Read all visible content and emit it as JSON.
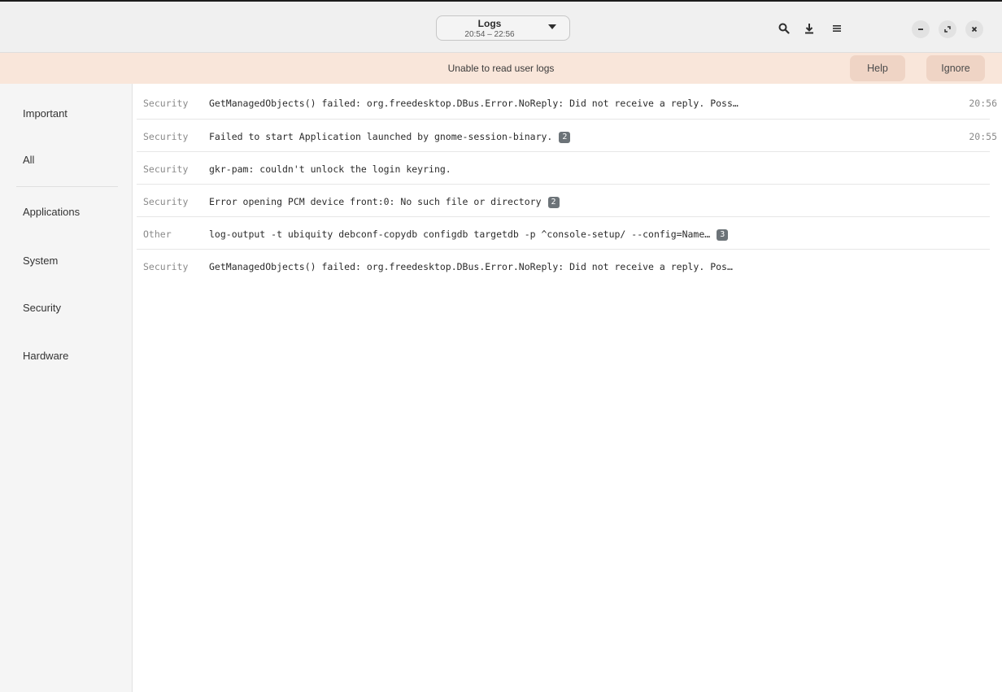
{
  "header": {
    "title": "Logs",
    "time_range": "20:54 – 22:56"
  },
  "infobar": {
    "message": "Unable to read user logs",
    "help_label": "Help",
    "ignore_label": "Ignore"
  },
  "sidebar": {
    "items": [
      {
        "label": "Important"
      },
      {
        "label": "All"
      },
      {
        "label": "Applications"
      },
      {
        "label": "System"
      },
      {
        "label": "Security"
      },
      {
        "label": "Hardware"
      }
    ]
  },
  "log_rows": [
    {
      "category": "Security",
      "message": "GetManagedObjects() failed: org.freedesktop.DBus.Error.NoReply: Did not receive a reply. Poss…",
      "count": "",
      "time": "20:56"
    },
    {
      "category": "Security",
      "message": "Failed to start Application launched by gnome-session-binary.",
      "count": "2",
      "time": "20:55"
    },
    {
      "category": "Security",
      "message": "gkr-pam: couldn't unlock the login keyring.",
      "count": "",
      "time": ""
    },
    {
      "category": "Security",
      "message": "Error opening PCM device front:0: No such file or directory",
      "count": "2",
      "time": ""
    },
    {
      "category": "Other",
      "message": "log-output -t ubiquity debconf-copydb configdb targetdb -p ^console-setup/ --config=Name…",
      "count": "3",
      "time": ""
    },
    {
      "category": "Security",
      "message": "GetManagedObjects() failed: org.freedesktop.DBus.Error.NoReply: Did not receive a reply. Pos…",
      "count": "",
      "time": ""
    }
  ],
  "icons": {
    "search": "search-icon",
    "export": "download-icon",
    "menu": "menu-icon",
    "minimize": "minimize-icon",
    "restore": "restore-icon",
    "close": "close-icon"
  },
  "colors": {
    "infobar_bg": "#f9e6da",
    "infobar_button": "#efd4c5",
    "badge": "#6c7378"
  }
}
